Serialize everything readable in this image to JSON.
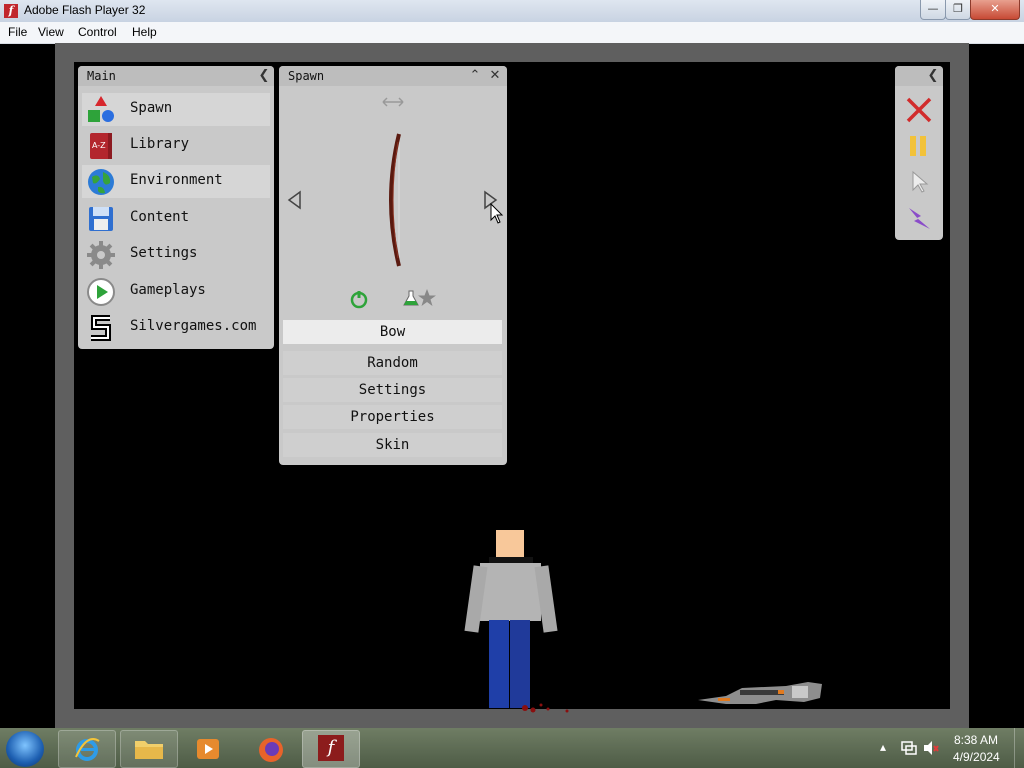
{
  "window": {
    "title": "Adobe Flash Player 32",
    "app_icon": "f"
  },
  "menubar": {
    "items": [
      "File",
      "View",
      "Control",
      "Help"
    ]
  },
  "main_panel": {
    "title": "Main",
    "items": [
      {
        "label": "Spawn",
        "icon": "shapes-icon"
      },
      {
        "label": "Library",
        "icon": "book-icon"
      },
      {
        "label": "Environment",
        "icon": "globe-icon"
      },
      {
        "label": "Content",
        "icon": "floppy-disk-icon"
      },
      {
        "label": "Settings",
        "icon": "gear-icon"
      },
      {
        "label": "Gameplays",
        "icon": "play-icon"
      },
      {
        "label": "Silvergames.com",
        "icon": "silvergames-logo-icon"
      }
    ]
  },
  "spawn_panel": {
    "title": "Spawn",
    "selected_item": "Bow",
    "buttons": [
      "Random",
      "Settings",
      "Properties",
      "Skin"
    ]
  },
  "toolbar": {
    "icons": [
      "close-icon",
      "pause-icon",
      "cursor-icon",
      "lightning-icon"
    ]
  },
  "taskbar": {
    "time": "8:38 AM",
    "date": "4/9/2024"
  },
  "colors": {
    "panel": "#c9c9c9",
    "game_bg": "#000000",
    "frame": "#5f5f5f",
    "shirt": "#b4b4b4",
    "pants": "#1f3fa8",
    "skin": "#f8c89a"
  }
}
